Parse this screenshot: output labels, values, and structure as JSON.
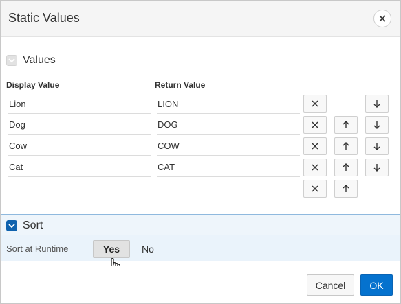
{
  "dialog": {
    "title": "Static Values",
    "close_icon": "close-icon"
  },
  "values_region": {
    "label": "Values",
    "toggle_icon": "chevron-down-icon",
    "columns": {
      "display": "Display Value",
      "return": "Return Value"
    },
    "rows": [
      {
        "display": "Lion",
        "return": "LION"
      },
      {
        "display": "Dog",
        "return": "DOG"
      },
      {
        "display": "Cow",
        "return": "COW"
      },
      {
        "display": "Cat",
        "return": "CAT"
      },
      {
        "display": "",
        "return": ""
      }
    ],
    "icons": {
      "remove": "close-icon",
      "up": "arrow-up-icon",
      "down": "arrow-down-icon"
    }
  },
  "sort_region": {
    "label": "Sort",
    "toggle_icon": "chevron-down-icon",
    "field_label": "Sort at Runtime",
    "options": [
      "Yes",
      "No"
    ],
    "selected": "Yes"
  },
  "footer": {
    "cancel_label": "Cancel",
    "ok_label": "OK"
  },
  "colors": {
    "accent": "#0572ce",
    "sort_bar": "#eef5fb"
  }
}
